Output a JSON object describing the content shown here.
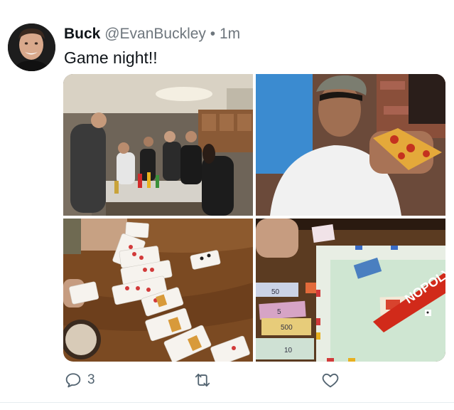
{
  "tweet": {
    "display_name": "Buck",
    "handle": "@EvanBuckley",
    "separator": "•",
    "timestamp": "1m",
    "text": "Game night!!",
    "photos": [
      {
        "subject": "group-in-kitchen"
      },
      {
        "subject": "man-eating-pizza"
      },
      {
        "subject": "card-game-on-table"
      },
      {
        "subject": "monopoly-board"
      }
    ],
    "photo_text": {
      "monopoly_logo": "NOPOLY",
      "money_50": "50",
      "money_5": "5",
      "money_500": "500",
      "money_10": "10"
    },
    "actions": {
      "reply_icon": "speech-bubble-icon",
      "reply_count": "3",
      "retweet_icon": "retweet-arrows-icon",
      "like_icon": "heart-outline-icon"
    }
  },
  "colors": {
    "text_primary": "#0f1419",
    "text_secondary": "#6e767d",
    "icon": "#536471"
  }
}
